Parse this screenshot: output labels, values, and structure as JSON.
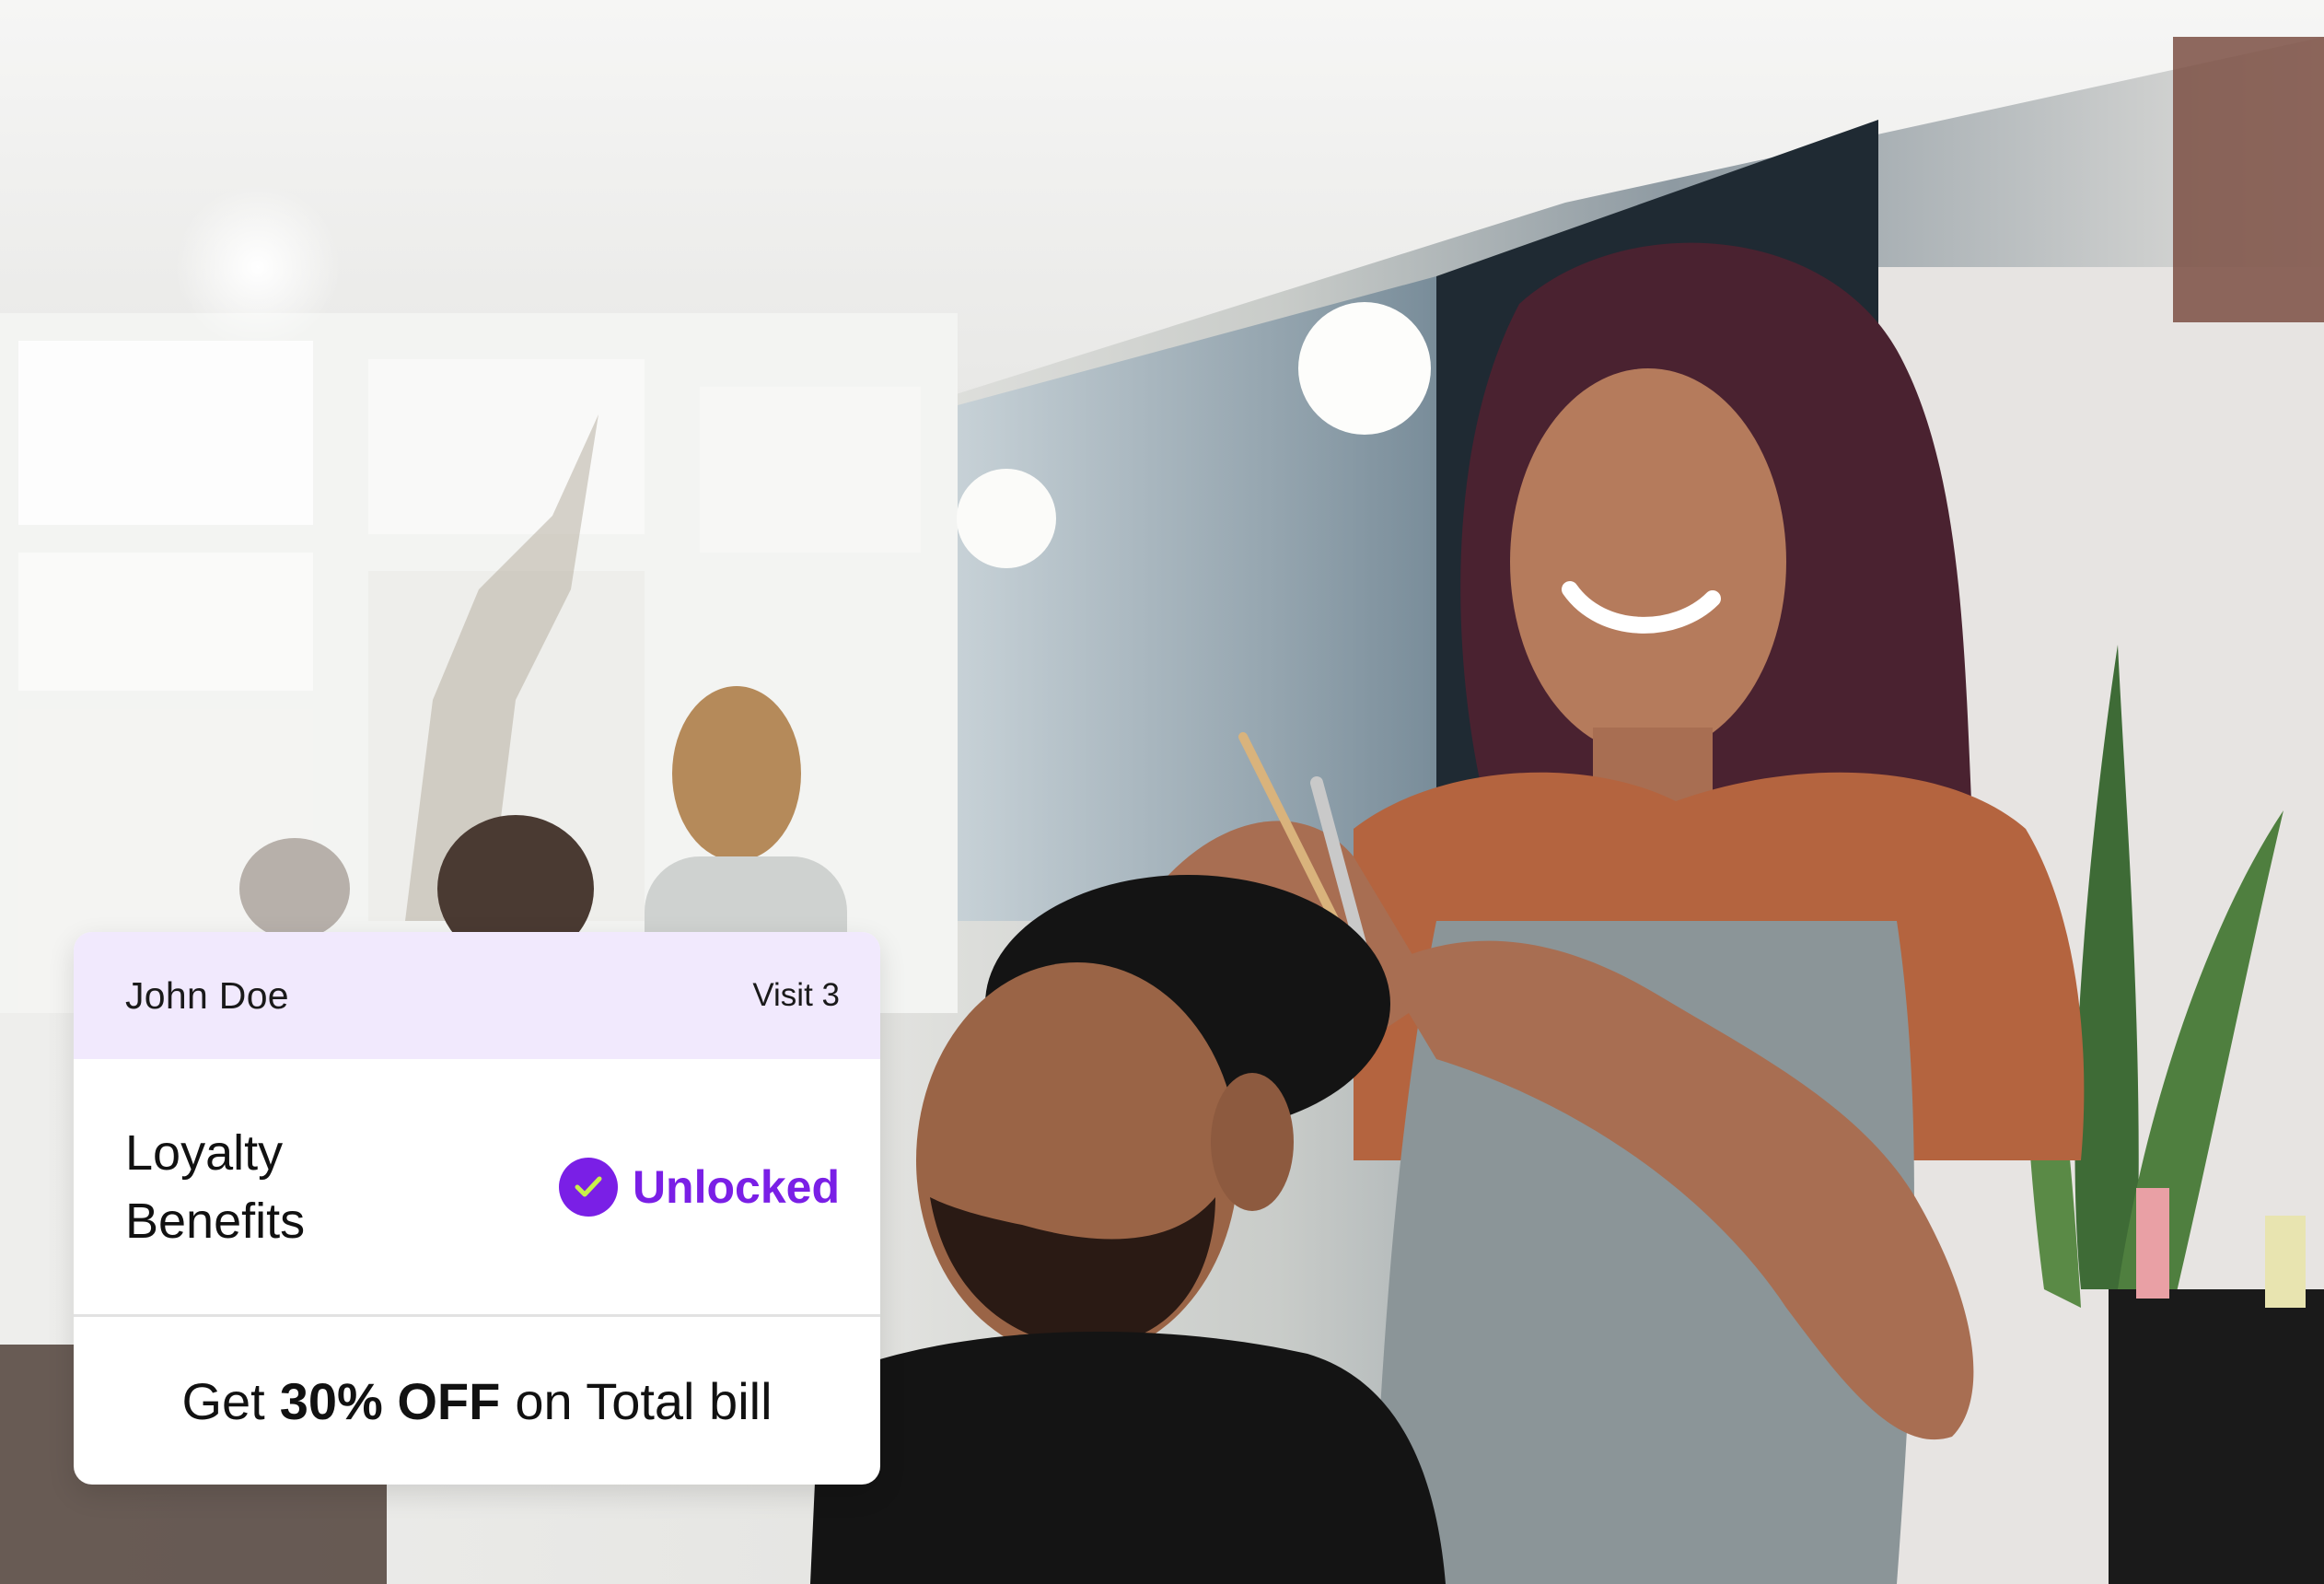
{
  "card": {
    "customer_name": "John Doe",
    "visit": "Visit 3",
    "benefits_title_line1": "Loyalty",
    "benefits_title_line2": "Benefits",
    "status": "Unlocked",
    "offer_prefix": "Get",
    "offer_highlight": "30% OFF",
    "offer_suffix": "on Total bill"
  },
  "colors": {
    "accent": "#7a1fe6",
    "check": "#c8f04a",
    "header_bg": "#f1e9fd"
  },
  "icons": {
    "status_icon": "check-circle-icon"
  }
}
